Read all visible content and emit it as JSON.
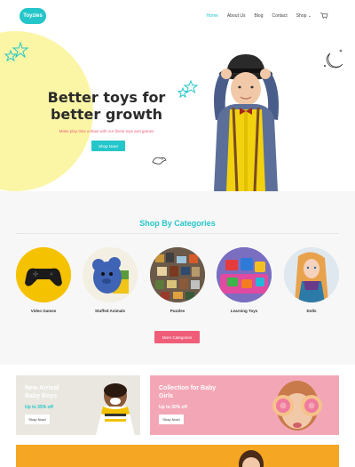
{
  "header": {
    "logo": "Toyzies",
    "nav": [
      {
        "label": "Home",
        "active": true
      },
      {
        "label": "About Us",
        "active": false
      },
      {
        "label": "Blog",
        "active": false
      },
      {
        "label": "Contact",
        "active": false
      },
      {
        "label": "Shop",
        "active": false
      }
    ],
    "cart_icon": "cart-icon"
  },
  "hero": {
    "title_line1": "Better toys for",
    "title_line2": "better growth",
    "subtitle": "Make play time a blast with our finest toys and games",
    "button": "Shop Now!"
  },
  "categories": {
    "title": "Shop By Categories",
    "items": [
      {
        "label": "Video Games"
      },
      {
        "label": "Stuffed Animals"
      },
      {
        "label": "Puzzles"
      },
      {
        "label": "Learning Toys"
      },
      {
        "label": "Dolls"
      }
    ],
    "more_button": "More Categories"
  },
  "banners": {
    "boys": {
      "title_line1": "New Arrival",
      "title_line2": "Baby Boys",
      "offer": "Up to 35% off",
      "button": "Shop Now!"
    },
    "girls": {
      "title_line1": "Collection for Baby",
      "title_line2": "Girls",
      "offer": "Up to 30% off",
      "button": "Shop Now!"
    }
  },
  "colors": {
    "accent": "#25c6c9",
    "pink": "#ef5d79",
    "hero_blob": "#fbf6a6",
    "orange": "#f5a623"
  }
}
